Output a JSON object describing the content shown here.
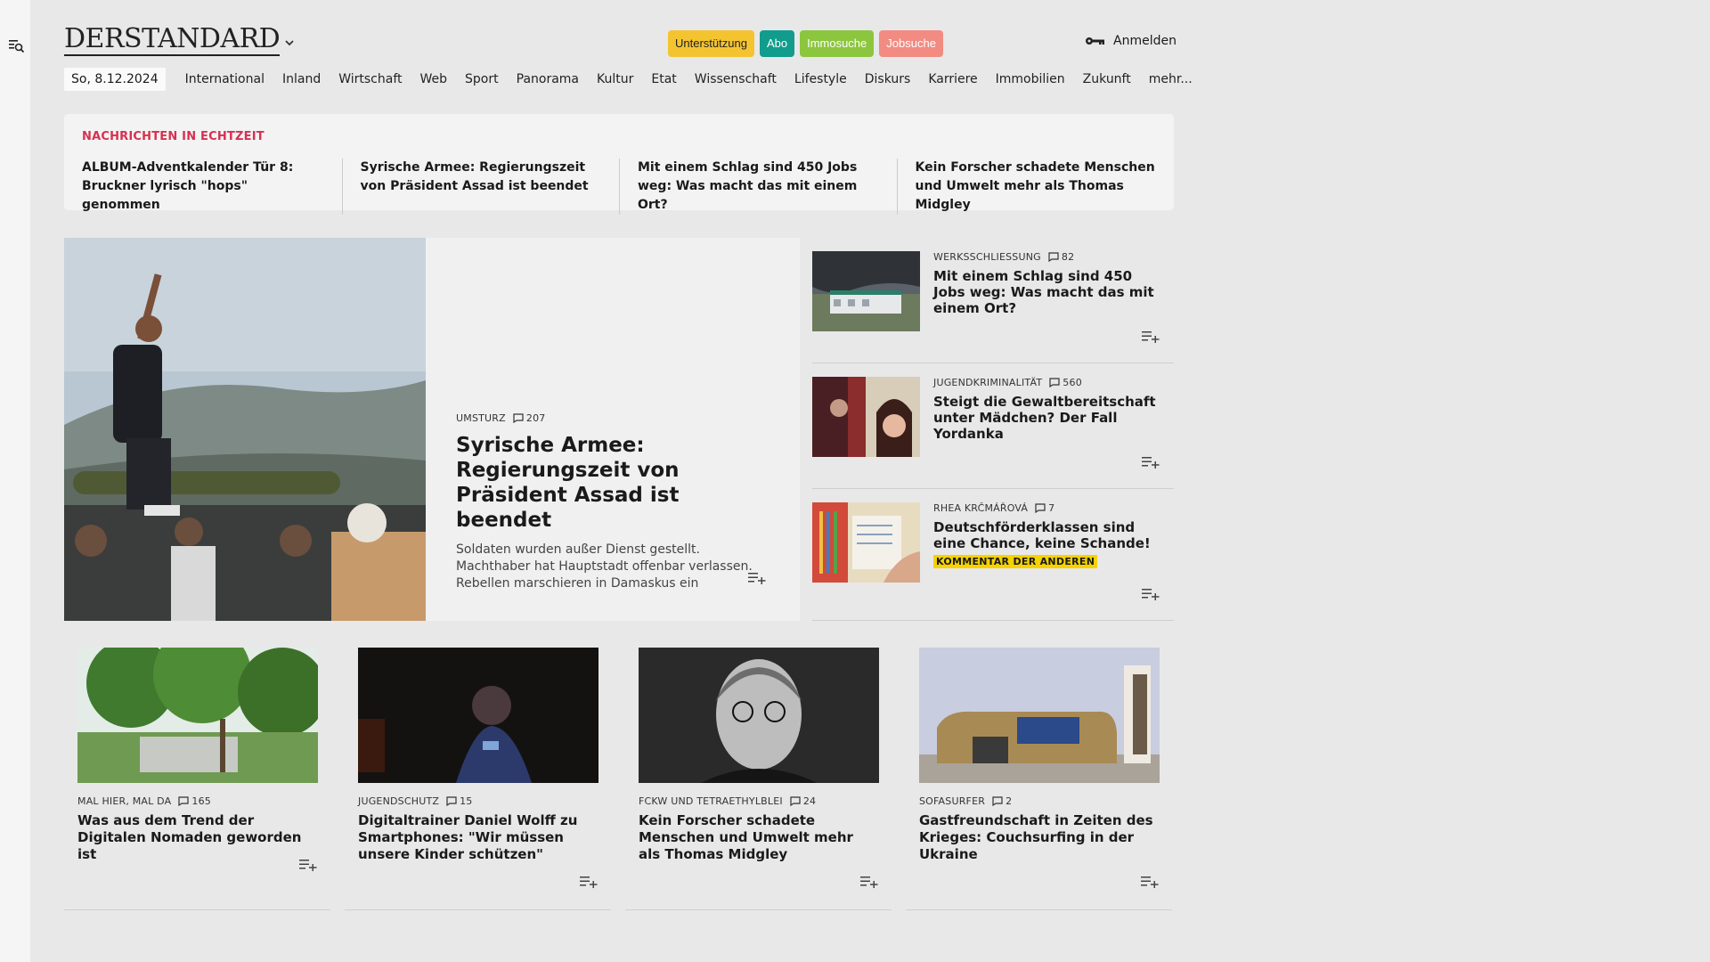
{
  "brand": {
    "logo": "DERSTANDARD"
  },
  "header": {
    "pills": [
      {
        "label": "Unterstützung",
        "bg": "#f4c430",
        "fg": "#222222"
      },
      {
        "label": "Abo",
        "bg": "#119c8d",
        "fg": "#ffffff"
      },
      {
        "label": "Immosuche",
        "bg": "#8cc63f",
        "fg": "#ffffff"
      },
      {
        "label": "Jobsuche",
        "bg": "#f28b82",
        "fg": "#ffffff"
      }
    ],
    "login_label": "Anmelden"
  },
  "nav": {
    "date": "So, 8.12.2024",
    "items": [
      "International",
      "Inland",
      "Wirtschaft",
      "Web",
      "Sport",
      "Panorama",
      "Kultur",
      "Etat",
      "Wissenschaft",
      "Lifestyle",
      "Diskurs",
      "Karriere",
      "Immobilien",
      "Zukunft",
      "mehr..."
    ]
  },
  "breaking": {
    "label": "NACHRICHTEN IN ECHTZEIT",
    "items": [
      "ALBUM-Adventkalender Tür 8: Bruckner lyrisch \"hops\" genommen",
      "Syrische Armee: Regierungszeit von Präsident Assad ist beendet",
      "Mit einem Schlag sind 450 Jobs weg: Was macht das mit einem Ort?",
      "Kein Forscher schadete Menschen und Umwelt mehr als Thomas Midgley"
    ]
  },
  "hero": {
    "kicker": "UMSTURZ",
    "comments": "207",
    "title": "Syrische Armee: Regierungszeit von Präsident Assad ist beendet",
    "teaser": "Soldaten wurden außer Dienst gestellt. Machthaber hat Hauptstadt offenbar verlassen. Rebellen marschieren in Damaskus ein"
  },
  "side": [
    {
      "kicker": "WERKSSCHLIESSUNG",
      "comments": "82",
      "title": "Mit einem Schlag sind 450 Jobs weg: Was macht das mit einem Ort?",
      "badge": ""
    },
    {
      "kicker": "JUGENDKRIMINALITÄT",
      "comments": "560",
      "title": "Steigt die Gewaltbereitschaft unter Mädchen? Der Fall Yordanka",
      "badge": ""
    },
    {
      "kicker": "RHEA KRČMÁŘOVÁ",
      "comments": "7",
      "title": "Deutschförderklassen sind eine Chance, keine Schande!",
      "badge": "KOMMENTAR DER ANDEREN"
    }
  ],
  "cards": [
    {
      "kicker": "MAL HIER, MAL DA",
      "comments": "165",
      "title": "Was aus dem Trend der Digitalen Nomaden geworden ist"
    },
    {
      "kicker": "JUGENDSCHUTZ",
      "comments": "15",
      "title": "Digitaltrainer Daniel Wolff zu Smartphones: \"Wir müssen unsere Kinder schützen\""
    },
    {
      "kicker": "FCKW UND TETRAETHYLBLEI",
      "comments": "24",
      "title": "Kein Forscher schadete Menschen und Umwelt mehr als Thomas Midgley"
    },
    {
      "kicker": "SOFASURFER",
      "comments": "2",
      "title": "Gastfreundschaft in Zeiten des Krieges: Couchsurfing in der Ukraine"
    }
  ],
  "colors": {
    "accent_red": "#d8304e",
    "badge_yellow": "#f5d200"
  }
}
